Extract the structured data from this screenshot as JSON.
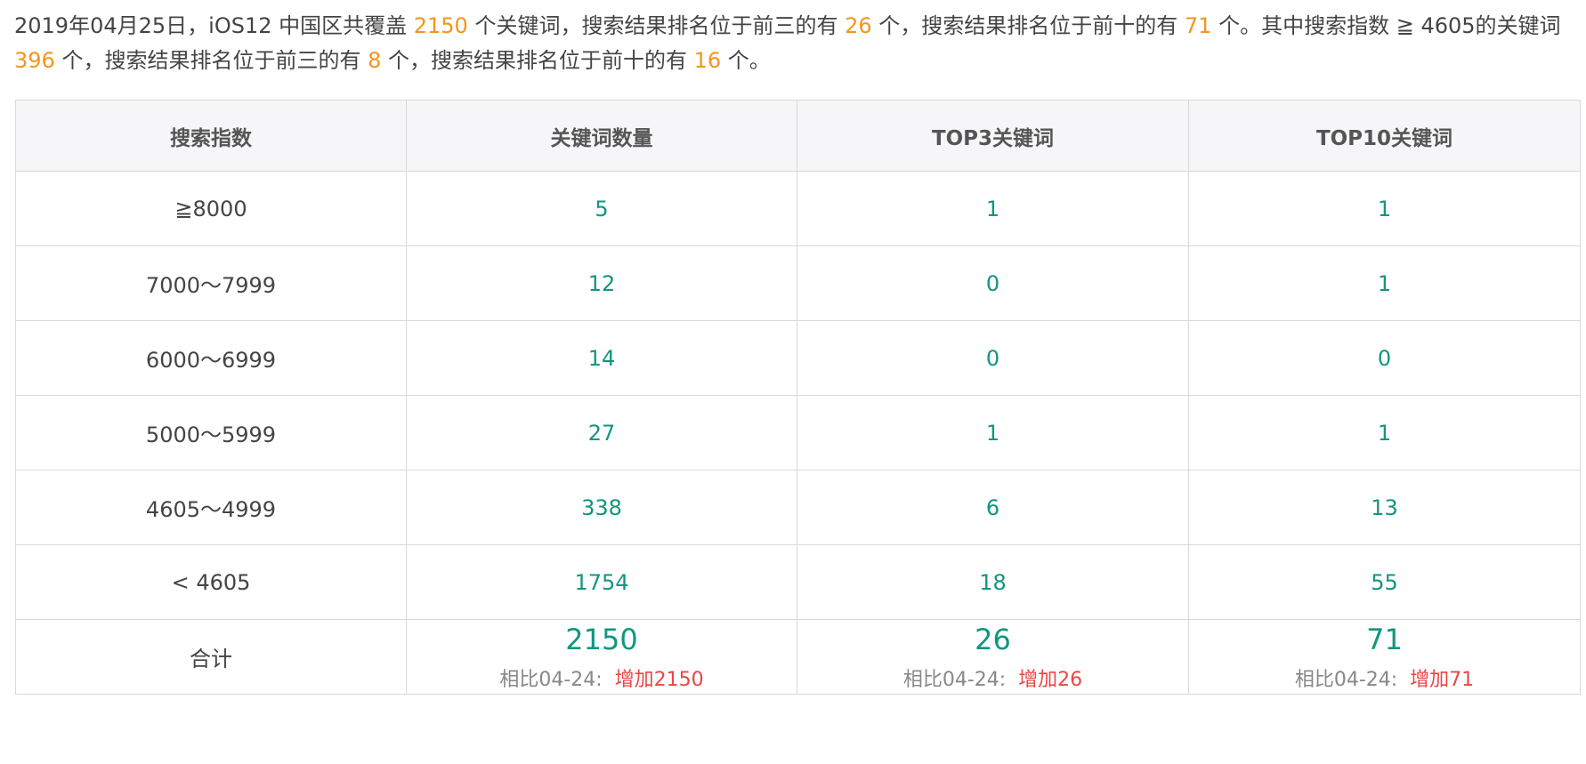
{
  "summary": {
    "p1": "2019年04月25日，iOS12 中国区共覆盖 ",
    "total": "2150",
    "p2": " 个关键词，搜索结果排名位于前三的有 ",
    "top3": "26",
    "p3": " 个，搜索结果排名位于前十的有 ",
    "top10": "71",
    "p4": " 个。其中搜索指数 ≧ 4605的关键词 ",
    "high_total": "396",
    "p5": " 个，搜索结果排名位于前三的有 ",
    "high_top3": "8",
    "p6": " 个，搜索结果排名位于前十的有 ",
    "high_top10": "16",
    "p7": " 个。"
  },
  "table": {
    "headers": [
      "搜索指数",
      "关键词数量",
      "TOP3关键词",
      "TOP10关键词"
    ],
    "rows": [
      [
        "≧8000",
        "5",
        "1",
        "1"
      ],
      [
        "7000～7999",
        "12",
        "0",
        "1"
      ],
      [
        "6000～6999",
        "14",
        "0",
        "0"
      ],
      [
        "5000～5999",
        "27",
        "1",
        "1"
      ],
      [
        "4605～4999",
        "338",
        "6",
        "13"
      ],
      [
        "< 4605",
        "1754",
        "18",
        "55"
      ]
    ],
    "total": {
      "label": "合计",
      "cells": [
        {
          "value": "2150",
          "compare": "相比04-24:",
          "change": "增加2150"
        },
        {
          "value": "26",
          "compare": "相比04-24:",
          "change": "增加26"
        },
        {
          "value": "71",
          "compare": "相比04-24:",
          "change": "增加71"
        }
      ]
    }
  },
  "colors": {
    "highlight": "#f7941d",
    "value": "#11967f",
    "increase": "#ee4444",
    "header_bg": "#f6f6f8",
    "border": "#d9d9d9"
  }
}
